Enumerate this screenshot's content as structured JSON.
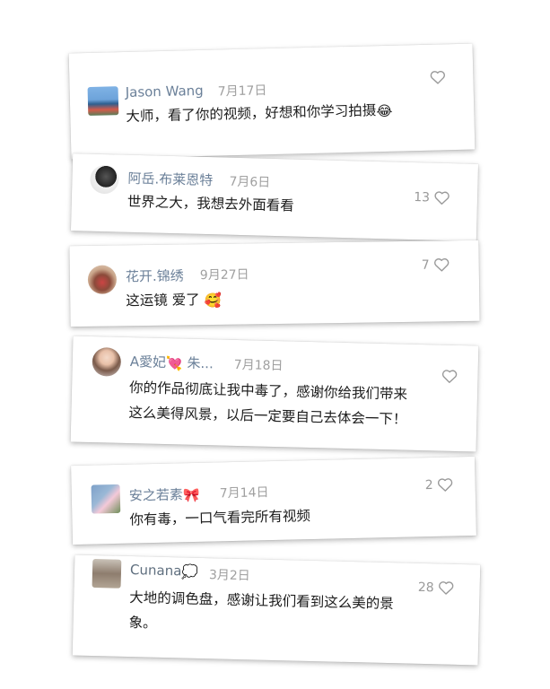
{
  "comments": [
    {
      "name": "Jason Wang",
      "date": "7月17日",
      "text": "大师，看了你的视频，好想和你学习拍摄",
      "emoji": "😂",
      "likes": ""
    },
    {
      "name": "阿岳.布莱恩特",
      "date": "7月6日",
      "text": "世界之大，我想去外面看看",
      "likes": "13"
    },
    {
      "name": "花开.锦绣",
      "date": "9月27日",
      "text": "这运镜 爱了",
      "emoji": "🥰",
      "likes": "7"
    },
    {
      "name": "A愛妃",
      "name_emoji": "💘",
      "name_more": "朱...",
      "date": "7月18日",
      "text_line1": "你的作品彻底让我中毒了，感谢你给我们带来",
      "text_line2": "这么美得风景，以后一定要自己去体会一下！",
      "likes": ""
    },
    {
      "name": "安之若素",
      "name_emoji": "🎀",
      "date": "7月14日",
      "text": "你有毒，一口气看完所有视频",
      "likes": "2"
    },
    {
      "name": "Cunana",
      "name_emoji": "💭",
      "date": "3月2日",
      "text_line1": "大地的调色盘，感谢让我们看到这么美的景",
      "text_line2": "象。",
      "likes": "28"
    }
  ],
  "icons": {
    "like": "heart-outline-icon"
  }
}
